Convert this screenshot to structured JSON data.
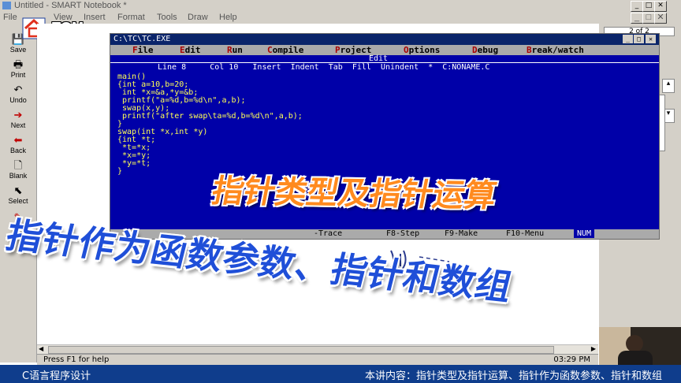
{
  "window": {
    "title": "Untitled - SMART Notebook *"
  },
  "menu": [
    "File",
    "View",
    "Insert",
    "Format",
    "Tools",
    "Draw",
    "Help"
  ],
  "logo": {
    "text": "TGM"
  },
  "tools": [
    {
      "label": "Save",
      "icon": "floppy-icon"
    },
    {
      "label": "Print",
      "icon": "printer-icon"
    },
    {
      "label": "Undo",
      "icon": "undo-icon"
    },
    {
      "label": "Next",
      "icon": "next-arrow-icon"
    },
    {
      "label": "Back",
      "icon": "back-arrow-icon"
    },
    {
      "label": "Blank",
      "icon": "blank-page-icon"
    },
    {
      "label": "Select",
      "icon": "pointer-icon"
    }
  ],
  "right_panel": {
    "page_indicator": "2 of 2"
  },
  "dos": {
    "title": "C:\\TC\\TC.EXE",
    "menu": [
      "File",
      "Edit",
      "Run",
      "Compile",
      "Project",
      "Options",
      "Debug",
      "Break/watch"
    ],
    "edit_label": "Edit",
    "status_line": "Line 8     Col 10   Insert  Indent  Tab  Fill  Unindent  *  C:NONAME.C",
    "code": [
      "main()",
      "{int a=10,b=20;",
      " int *x=&a,*y=&b;",
      " printf(\"a=%d,b=%d\\n\",a,b);",
      " swap(x,y);",
      " printf(\"after swap\\ta=%d,b=%d\\n\",a,b);",
      "}",
      "swap(int *x,int *y)",
      "{int *t;",
      " *t=*x;",
      " *x=*y;",
      " *y=*t;",
      "}"
    ],
    "fkeys": {
      "trace": "-Trace",
      "f8": "F8-Step",
      "f9": "F9-Make",
      "f10": "F10-Menu",
      "num": "NUM"
    }
  },
  "overlay": {
    "title1": "指针类型及指针运算",
    "title2": "指针作为函数参数、指针和数组"
  },
  "statusbar": {
    "help": "Press F1 for help",
    "time": "03:29 PM"
  },
  "bottom": {
    "course": "C语言程序设计",
    "lecture": "本讲内容：指针类型及指针运算、指针作为函数参数、指针和数组"
  },
  "colors": {
    "dos_bg": "#0000a8",
    "code_text": "#ffff55",
    "overlay_orange": "#ff8a1e",
    "overlay_blue": "#1f4fd8",
    "bottom_bar": "#0f3d8c"
  }
}
